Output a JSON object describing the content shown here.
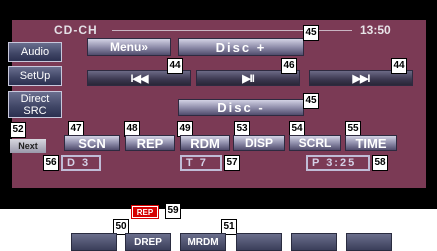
{
  "header": {
    "source": "CD-CH",
    "clock": "13:50"
  },
  "side": {
    "audio": "Audio",
    "setup": "SetUp",
    "direct_src": "Direct SRC",
    "next": "Next"
  },
  "controls": {
    "menu": "Menu»",
    "disc_plus": "Disc +",
    "disc_minus": "Disc -",
    "prev": "I◀◀",
    "play_pause": "▶II",
    "next_track": "▶▶I"
  },
  "functions": {
    "scn": "SCN",
    "rep": "REP",
    "rdm": "RDM",
    "disp": "DISP",
    "scrl": "SCRL",
    "time": "TIME"
  },
  "status": {
    "disc": "D 3",
    "track": "T 7",
    "play_time": "P 3:25"
  },
  "indicators": {
    "rep": "REP"
  },
  "bottom": {
    "drep": "DREP",
    "mrdm": "MRDM"
  },
  "callouts": {
    "c44a": "44",
    "c44b": "44",
    "c44c": "44",
    "c45a": "45",
    "c45b": "45",
    "c46": "46",
    "c47": "47",
    "c48": "48",
    "c49": "49",
    "c50": "50",
    "c51": "51",
    "c52": "52",
    "c53": "53",
    "c54": "54",
    "c55": "55",
    "c56": "56",
    "c57": "57",
    "c58": "58",
    "c59": "59"
  }
}
